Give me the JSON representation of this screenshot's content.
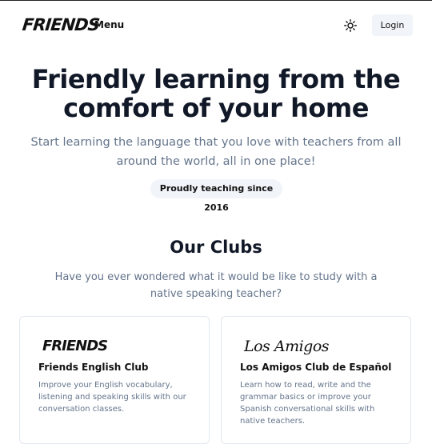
{
  "header": {
    "logo_text": "FRIENDS",
    "menu_label": "Menu",
    "theme_icon": "sun-icon",
    "login_label": "Login"
  },
  "hero": {
    "title_line1": "Friendly learning from the",
    "title_line2": "comfort of your home",
    "subtitle": "Start learning the language that you love with teachers from all around the world, all in one place!",
    "badge": "Proudly teaching since 2016"
  },
  "clubs": {
    "title": "Our Clubs",
    "subtitle": "Have you ever wondered what it would be like to study with a native speaking teacher?",
    "items": [
      {
        "logo_text": "FRIENDS",
        "title": "Friends English Club",
        "description": "Improve your English vocabulary, listening and speaking skills with our conversation classes."
      },
      {
        "logo_text": "Los Amigos",
        "title": "Los Amigos Club de Español",
        "description": "Learn how to read, write and the grammar basics or improve your Spanish conversational skills with native teachers."
      }
    ]
  },
  "colors": {
    "heading": "#111827",
    "muted": "#64748b",
    "badge_bg": "#f1f5f9",
    "card_border": "#e2e8f0"
  }
}
